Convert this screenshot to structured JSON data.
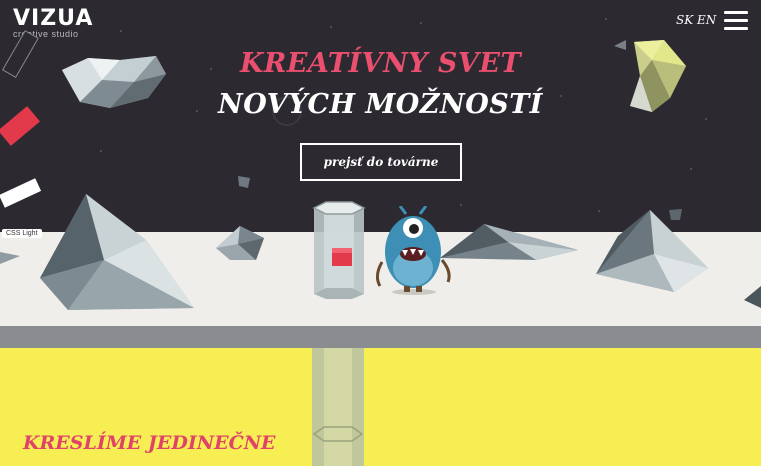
{
  "brand": {
    "name": "VIZUA",
    "tagline": "creative studio"
  },
  "languages": [
    "SK",
    "EN"
  ],
  "menu": {
    "icon": "hamburger-icon"
  },
  "hero": {
    "title_line1": "KREATÍVNY SVET",
    "title_line2": "NOVÝCH MOŽNOSTÍ",
    "cta_label": "prejsť do továrne"
  },
  "awards": {
    "css_light": "CSS Light"
  },
  "section": {
    "title": "KRESLÍME JEDINEČNE"
  },
  "colors": {
    "sky": "#2c2a30",
    "accent_pink": "#ea4f6f",
    "floor": "#efeeea",
    "yellow": "#f6ee52",
    "monster": "#3d8fb5"
  }
}
